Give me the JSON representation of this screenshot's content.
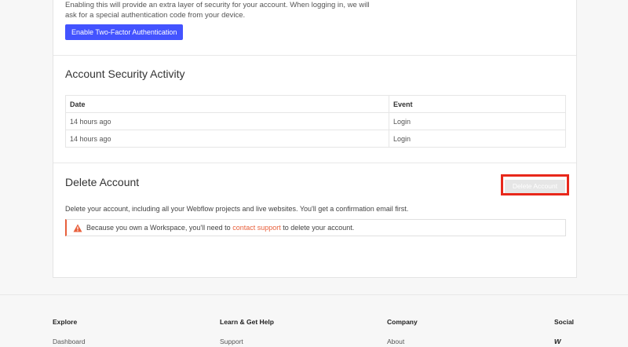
{
  "two_factor": {
    "description": "Enabling this will provide an extra layer of security for your account. When logging in, we will ask for a special authentication code from your device.",
    "button_label": "Enable Two-Factor Authentication"
  },
  "security_activity": {
    "title": "Account Security Activity",
    "columns": [
      "Date",
      "Event"
    ],
    "rows": [
      {
        "date": "14 hours ago",
        "event": "Login"
      },
      {
        "date": "14 hours ago",
        "event": "Login"
      }
    ]
  },
  "delete_account": {
    "title": "Delete Account",
    "button_label": "Delete Account",
    "description": "Delete your account, including all your Webflow projects and live websites. You'll get a confirmation email first.",
    "alert_prefix": "Because you own a Workspace, you'll need to",
    "alert_link": "contact support",
    "alert_suffix": "to delete your account."
  },
  "footer": {
    "columns": [
      {
        "heading": "Explore",
        "link": "Dashboard"
      },
      {
        "heading": "Learn & Get Help",
        "link": "Support"
      },
      {
        "heading": "Company",
        "link": "About"
      },
      {
        "heading": "Social",
        "icon": "webflow-icon",
        "glyph": "w"
      }
    ]
  },
  "colors": {
    "primary": "#4353ff",
    "highlight": "#e8281b",
    "warning": "#e8603c"
  }
}
